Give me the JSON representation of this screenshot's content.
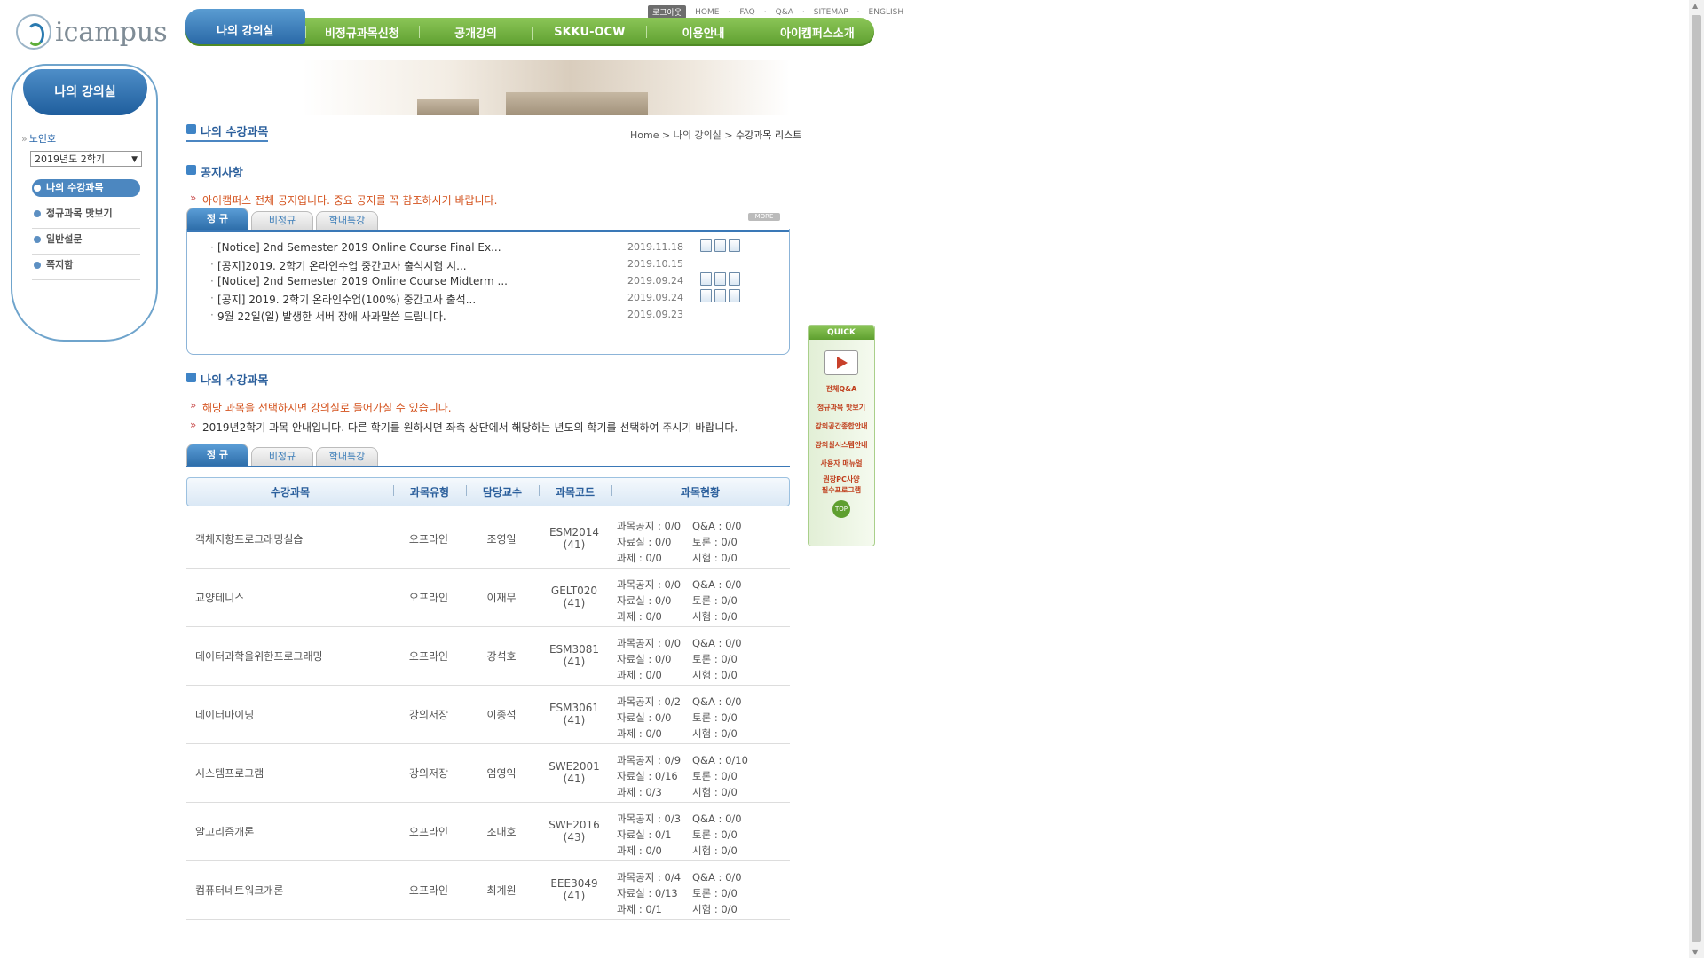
{
  "logo": {
    "text": "icampus"
  },
  "util": {
    "logout": "로그아웃",
    "links": [
      "HOME",
      "FAQ",
      "Q&A",
      "SITEMAP",
      "ENGLISH"
    ]
  },
  "gnb": {
    "items": [
      "나의 강의실",
      "비정규과목신청",
      "공개강의",
      "SKKU-OCW",
      "이용안내",
      "아이캠퍼스소개"
    ]
  },
  "sidebar": {
    "title": "나의 강의실",
    "user": "노인호",
    "semester": "2019년도 2학기",
    "menu": [
      "나의 수강과목",
      "정규과목 맛보기",
      "일반설문",
      "쪽지함"
    ]
  },
  "page": {
    "title": "나의 수강과목",
    "breadcrumb": {
      "home": "Home",
      "sep1": ">",
      "mid": "나의 강의실",
      "sep2": ">",
      "current": "수강과목 리스트"
    }
  },
  "notices": {
    "heading": "공지사항",
    "desc": "아이캠퍼스 전체 공지입니다. 중요 공지를 꼭 참조하시기 바랍니다.",
    "tabs": [
      "정 규",
      "비정규",
      "학내특강"
    ],
    "more": "MORE",
    "items": [
      {
        "title": "[Notice] 2nd Semester 2019 Online Course Final Ex...",
        "date": "2019.11.18"
      },
      {
        "title": "[공지]2019. 2학기 온라인수업 중간고사 출석시험 시...",
        "date": "2019.10.15"
      },
      {
        "title": "[Notice] 2nd Semester 2019 Online Course Midterm ...",
        "date": "2019.09.24"
      },
      {
        "title": "[공지] 2019. 2학기 온라인수업(100%) 중간고사 출석...",
        "date": "2019.09.24"
      },
      {
        "title": "9월 22일(일) 발생한 서버 장애 사과말씀 드립니다.",
        "date": "2019.09.23"
      }
    ]
  },
  "courses": {
    "heading": "나의 수강과목",
    "desc1": "해당 과목을 선택하시면 강의실로 들어가실 수 있습니다.",
    "desc2": "2019년2학기 과목 안내입니다. 다른 학기를 원하시면 좌측 상단에서 해당하는 년도의 학기를 선택하여 주시기 바랍니다.",
    "tabs": [
      "정 규",
      "비정규",
      "학내특강"
    ],
    "columns": [
      "수강과목",
      "과목유형",
      "담당교수",
      "과목코드",
      "과목현황"
    ],
    "rows": [
      {
        "name": "객체지향프로그래밍실습",
        "type": "오프라인",
        "prof": "조영일",
        "code": "ESM2014",
        "sec": "(41)",
        "s1": "과목공지 : 0/0",
        "s2": "Q&A : 0/0",
        "s3": "자료실 : 0/0",
        "s4": "토론 : 0/0",
        "s5": "과제 : 0/0",
        "s6": "시험 : 0/0"
      },
      {
        "name": "교양테니스",
        "type": "오프라인",
        "prof": "이재무",
        "code": "GELT020",
        "sec": "(41)",
        "s1": "과목공지 : 0/0",
        "s2": "Q&A : 0/0",
        "s3": "자료실 : 0/0",
        "s4": "토론 : 0/0",
        "s5": "과제 : 0/0",
        "s6": "시험 : 0/0"
      },
      {
        "name": "데이터과학을위한프로그래밍",
        "type": "오프라인",
        "prof": "강석호",
        "code": "ESM3081",
        "sec": "(41)",
        "s1": "과목공지 : 0/0",
        "s2": "Q&A : 0/0",
        "s3": "자료실 : 0/0",
        "s4": "토론 : 0/0",
        "s5": "과제 : 0/0",
        "s6": "시험 : 0/0"
      },
      {
        "name": "데이터마이닝",
        "type": "강의저장",
        "prof": "이종석",
        "code": "ESM3061",
        "sec": "(41)",
        "s1": "과목공지 : 0/2",
        "s2": "Q&A : 0/0",
        "s3": "자료실 : 0/0",
        "s4": "토론 : 0/0",
        "s5": "과제 : 0/0",
        "s6": "시험 : 0/0"
      },
      {
        "name": "시스템프로그램",
        "type": "강의저장",
        "prof": "엄영익",
        "code": "SWE2001",
        "sec": "(41)",
        "s1": "과목공지 : 0/9",
        "s2": "Q&A : 0/10",
        "s3": "자료실 : 0/16",
        "s4": "토론 : 0/0",
        "s5": "과제 : 0/3",
        "s6": "시험 : 0/0"
      },
      {
        "name": "알고리즘개론",
        "type": "오프라인",
        "prof": "조대호",
        "code": "SWE2016",
        "sec": "(43)",
        "s1": "과목공지 : 0/3",
        "s2": "Q&A : 0/0",
        "s3": "자료실 : 0/1",
        "s4": "토론 : 0/0",
        "s5": "과제 : 0/0",
        "s6": "시험 : 0/0"
      },
      {
        "name": "컴퓨터네트워크개론",
        "type": "오프라인",
        "prof": "최계원",
        "code": "EEE3049",
        "sec": "(41)",
        "s1": "과목공지 : 0/4",
        "s2": "Q&A : 0/0",
        "s3": "자료실 : 0/13",
        "s4": "토론 : 0/0",
        "s5": "과제 : 0/1",
        "s6": "시험 : 0/0"
      }
    ]
  },
  "quick": {
    "title": "QUICK",
    "links": [
      "전체Q&A",
      "정규과목 맛보기",
      "강의공간종합안내",
      "강의실시스템안내",
      "사용자 매뉴얼",
      "권장PC사양",
      "필수프로그램"
    ],
    "top": "TOP"
  },
  "colors": {
    "gnb_green": "#6aa83b",
    "active_blue": "#2a69a7",
    "notice_orange": "#d4531e"
  }
}
